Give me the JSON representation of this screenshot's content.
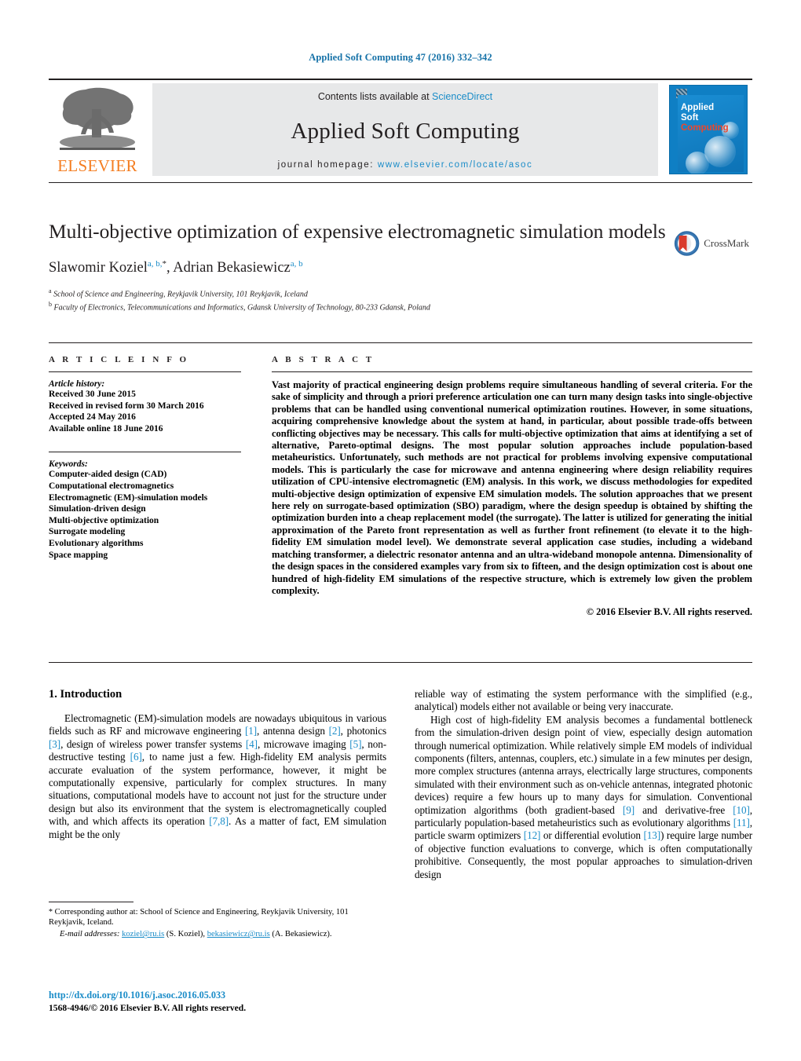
{
  "running_head": "Applied Soft Computing 47 (2016) 332–342",
  "masthead": {
    "publisher": "ELSEVIER",
    "contents_prefix": "Contents lists available at ",
    "contents_link": "ScienceDirect",
    "journal_title": "Applied Soft Computing",
    "homepage_label": "journal homepage: ",
    "homepage_url": "www.elsevier.com/locate/asoc",
    "cover": {
      "line1": "Applied",
      "line2": "Soft",
      "line3": "Computing"
    }
  },
  "article": {
    "title": "Multi-objective optimization of expensive electromagnetic simulation models",
    "authors_html": "Slawomir Koziel, Adrian Bekasiewicz",
    "author1": "Slawomir Koziel",
    "author1_sup": "a, b,",
    "author1_star": "*",
    "author2": ", Adrian Bekasiewicz",
    "author2_sup": "a, b",
    "affiliation_a_sup": "a",
    "affiliation_a": " School of Science and Engineering, Reykjavik University, 101 Reykjavik, Iceland",
    "affiliation_b_sup": "b",
    "affiliation_b": " Faculty of Electronics, Telecommunications and Informatics, Gdansk University of Technology, 80-233 Gdansk, Poland",
    "crossmark_label": "CrossMark"
  },
  "info": {
    "heading": "A R T I C L E    I N F O",
    "history_label": "Article history:",
    "history": [
      "Received 30 June 2015",
      "Received in revised form 30 March 2016",
      "Accepted 24 May 2016",
      "Available online 18 June 2016"
    ],
    "keywords_label": "Keywords:",
    "keywords": [
      "Computer-aided design (CAD)",
      "Computational electromagnetics",
      "Electromagnetic (EM)-simulation models",
      "Simulation-driven design",
      "Multi-objective optimization",
      "Surrogate modeling",
      "Evolutionary algorithms",
      "Space mapping"
    ]
  },
  "abstract": {
    "heading": "A B S T R A C T",
    "text": "Vast majority of practical engineering design problems require simultaneous handling of several criteria. For the sake of simplicity and through a priori preference articulation one can turn many design tasks into single-objective problems that can be handled using conventional numerical optimization routines. However, in some situations, acquiring comprehensive knowledge about the system at hand, in particular, about possible trade-offs between conflicting objectives may be necessary. This calls for multi-objective optimization that aims at identifying a set of alternative, Pareto-optimal designs. The most popular solution approaches include population-based metaheuristics. Unfortunately, such methods are not practical for problems involving expensive computational models. This is particularly the case for microwave and antenna engineering where design reliability requires utilization of CPU-intensive electromagnetic (EM) analysis. In this work, we discuss methodologies for expedited multi-objective design optimization of expensive EM simulation models. The solution approaches that we present here rely on surrogate-based optimization (SBO) paradigm, where the design speedup is obtained by shifting the optimization burden into a cheap replacement model (the surrogate). The latter is utilized for generating the initial approximation of the Pareto front representation as well as further front refinement (to elevate it to the high-fidelity EM simulation model level). We demonstrate several application case studies, including a wideband matching transformer, a dielectric resonator antenna and an ultra-wideband monopole antenna. Dimensionality of the design spaces in the considered examples vary from six to fifteen, and the design optimization cost is about one hundred of high-fidelity EM simulations of the respective structure, which is extremely low given the problem complexity.",
    "copyright": "© 2016 Elsevier B.V. All rights reserved."
  },
  "introduction": {
    "heading": "1.  Introduction",
    "left_p1_segments": [
      {
        "t": "Electromagnetic (EM)-simulation models are nowadays ubiquitous in various fields such as RF and microwave engineering "
      },
      {
        "t": "[1]",
        "ref": true
      },
      {
        "t": ", antenna design "
      },
      {
        "t": "[2]",
        "ref": true
      },
      {
        "t": ", photonics "
      },
      {
        "t": "[3]",
        "ref": true
      },
      {
        "t": ", design of wireless power transfer systems "
      },
      {
        "t": "[4]",
        "ref": true
      },
      {
        "t": ", microwave imaging "
      },
      {
        "t": "[5]",
        "ref": true
      },
      {
        "t": ", non-destructive testing "
      },
      {
        "t": "[6]",
        "ref": true
      },
      {
        "t": ", to name just a few. High-fidelity EM analysis permits accurate evaluation of the system performance, however, it might be computationally expensive, particularly for complex structures. In many situations, computational models have to account not just for the structure under design but also its environment that the system is electromagnetically coupled with, and which affects its operation "
      },
      {
        "t": "[7,8]",
        "ref": true
      },
      {
        "t": ". As a matter of fact, EM simulation might be the only"
      }
    ],
    "right_p1": "reliable way of estimating the system performance with the simplified (e.g., analytical) models either not available or being very inaccurate.",
    "right_p2_segments": [
      {
        "t": "High cost of high-fidelity EM analysis becomes a fundamental bottleneck from the simulation-driven design point of view, especially design automation through numerical optimization. While relatively simple EM models of individual components (filters, antennas, couplers, etc.) simulate in a few minutes per design, more complex structures (antenna arrays, electrically large structures, components simulated with their environment such as on-vehicle antennas, integrated photonic devices) require a few hours up to many days for simulation. Conventional optimization algorithms (both gradient-based "
      },
      {
        "t": "[9]",
        "ref": true
      },
      {
        "t": " and derivative-free "
      },
      {
        "t": "[10]",
        "ref": true
      },
      {
        "t": ", particularly population-based metaheuristics such as evolutionary algorithms "
      },
      {
        "t": "[11]",
        "ref": true
      },
      {
        "t": ", particle swarm optimizers "
      },
      {
        "t": "[12]",
        "ref": true
      },
      {
        "t": " or differential evolution "
      },
      {
        "t": "[13]",
        "ref": true
      },
      {
        "t": ") require large number of objective function evaluations to converge, which is often computationally prohibitive. Consequently, the most popular approaches to simulation-driven design"
      }
    ]
  },
  "footnotes": {
    "corresponding_star": "*",
    "corresponding": " Corresponding author at: School of Science and Engineering, Reykjavik University, 101 Reykjavik, Iceland.",
    "email_label": "E-mail addresses:",
    "email1": "koziel@ru.is",
    "email1_name": " (S. Koziel),",
    "email2": "bekasiewicz@ru.is",
    "email2_name": " (A. Bekasiewicz)."
  },
  "doi": {
    "url": "http://dx.doi.org/10.1016/j.asoc.2016.05.033",
    "issn": "1568-4946/© 2016 Elsevier B.V. All rights reserved."
  },
  "colors": {
    "link": "#1a8cc8",
    "runhead": "#1672a8",
    "elsevier_orange": "#f47d20",
    "band_gray": "#e7e8e9",
    "cover_blue": "#0f7fc4",
    "cover_red": "#f0462a"
  }
}
